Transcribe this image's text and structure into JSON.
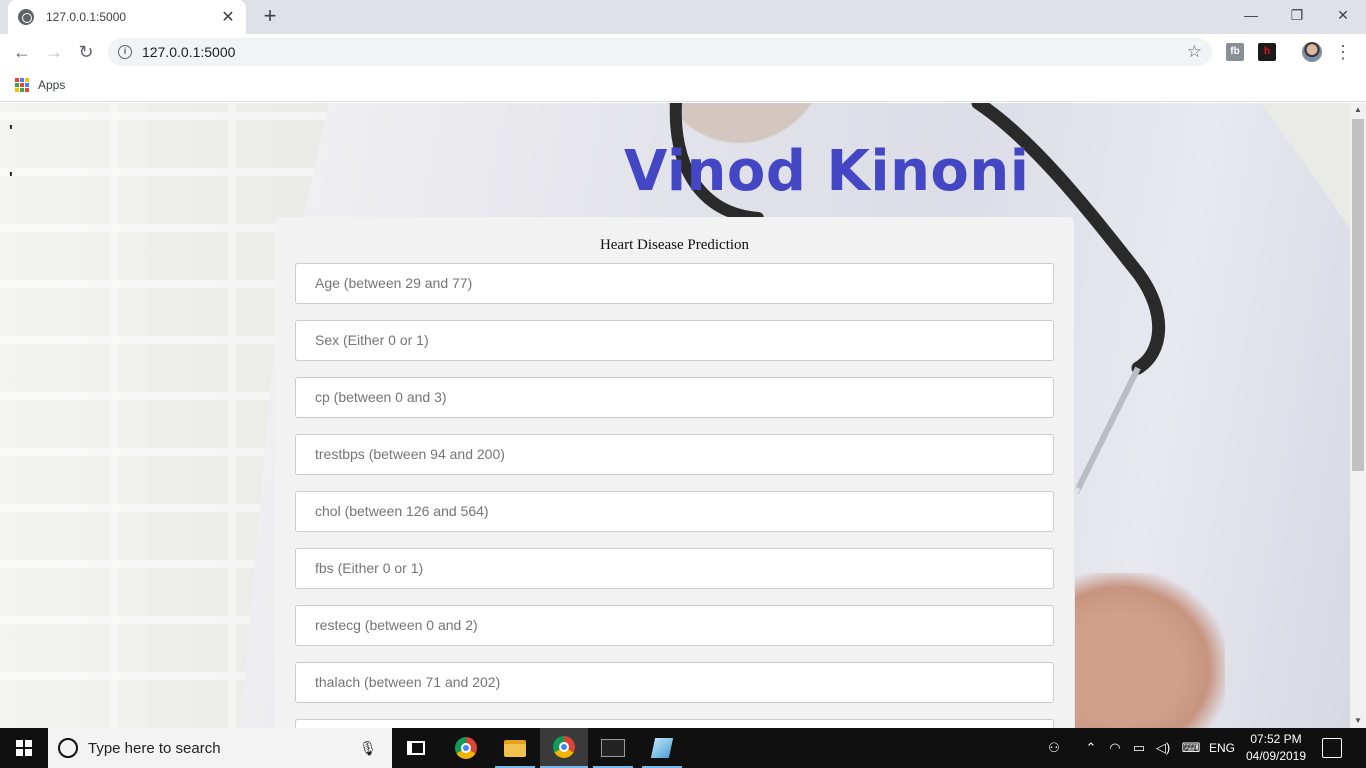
{
  "browser": {
    "tab_title": "127.0.0.1:5000",
    "tab_close": "✕",
    "new_tab": "+",
    "window_controls": {
      "minimize": "—",
      "maximize": "❐",
      "close": "✕"
    },
    "url": "127.0.0.1:5000",
    "bookmarks": {
      "apps_label": "Apps"
    },
    "extensions": {
      "fb_label": "fb",
      "h_label": "h"
    }
  },
  "page": {
    "stray_marks": [
      "'",
      "'"
    ],
    "heading": "Vinod Kinoni",
    "form": {
      "title": "Heart Disease Prediction",
      "fields": [
        {
          "placeholder": "Age (between 29 and 77)",
          "value": ""
        },
        {
          "placeholder": "Sex (Either 0 or 1)",
          "value": ""
        },
        {
          "placeholder": "cp (between 0 and 3)",
          "value": ""
        },
        {
          "placeholder": "trestbps (between 94 and 200)",
          "value": ""
        },
        {
          "placeholder": "chol (between 126 and 564)",
          "value": ""
        },
        {
          "placeholder": "fbs (Either 0 or 1)",
          "value": ""
        },
        {
          "placeholder": "restecg (between 0 and 2)",
          "value": ""
        },
        {
          "placeholder": "thalach (between 71 and 202)",
          "value": ""
        },
        {
          "placeholder": "",
          "value": ""
        }
      ]
    }
  },
  "taskbar": {
    "search_placeholder": "Type here to search",
    "language": "ENG",
    "time": "07:52 PM",
    "date": "04/09/2019"
  },
  "colors": {
    "heading": "#4347c4",
    "card_bg": "#f2f2f2",
    "taskbar_bg": "#101010",
    "accent": "#76b9ed"
  }
}
